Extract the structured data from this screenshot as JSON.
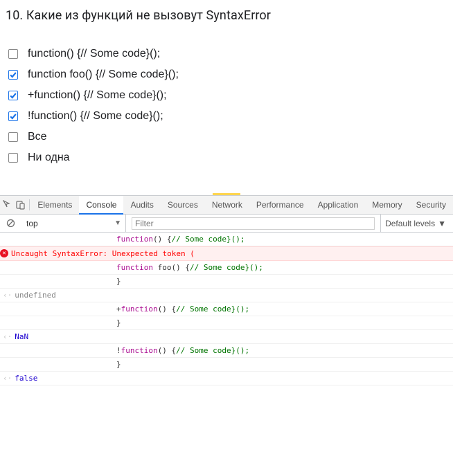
{
  "question": {
    "title": "10. Какие из функций не вызовут SyntaxError",
    "options": [
      {
        "label": "function() {// Some code}();",
        "checked": false
      },
      {
        "label": "function foo() {// Some code}();",
        "checked": true
      },
      {
        "label": "+function() {// Some code}();",
        "checked": true
      },
      {
        "label": "!function() {// Some code}();",
        "checked": true
      },
      {
        "label": "Все",
        "checked": false
      },
      {
        "label": "Ни одна",
        "checked": false
      }
    ]
  },
  "devtools": {
    "tabs": [
      "Elements",
      "Console",
      "Audits",
      "Sources",
      "Network",
      "Performance",
      "Application",
      "Memory",
      "Security"
    ],
    "activeTab": "Console",
    "context": "top",
    "filterPlaceholder": "Filter",
    "levels": "Default levels",
    "console": {
      "entries": [
        {
          "type": "input",
          "code": {
            "pre": "",
            "kw": "function",
            "mid": "() {",
            "comment": "// Some code}();"
          }
        },
        {
          "type": "error",
          "text": "Uncaught SyntaxError: Unexpected token ("
        },
        {
          "type": "input",
          "code": {
            "pre": "",
            "kw": "function",
            "mid": " foo() {",
            "comment": "// Some code}();"
          },
          "closingBrace": "}"
        },
        {
          "type": "result",
          "value": "undefined",
          "cls": "undef"
        },
        {
          "type": "input",
          "code": {
            "pre": "+",
            "kw": "function",
            "mid": "() {",
            "comment": "// Some code}();"
          },
          "closingBrace": "}"
        },
        {
          "type": "result",
          "value": "NaN",
          "cls": "nan"
        },
        {
          "type": "input",
          "code": {
            "pre": "!",
            "kw": "function",
            "mid": "() {",
            "comment": "// Some code}();"
          },
          "closingBrace": "}"
        },
        {
          "type": "result",
          "value": "false",
          "cls": "false"
        }
      ]
    }
  }
}
